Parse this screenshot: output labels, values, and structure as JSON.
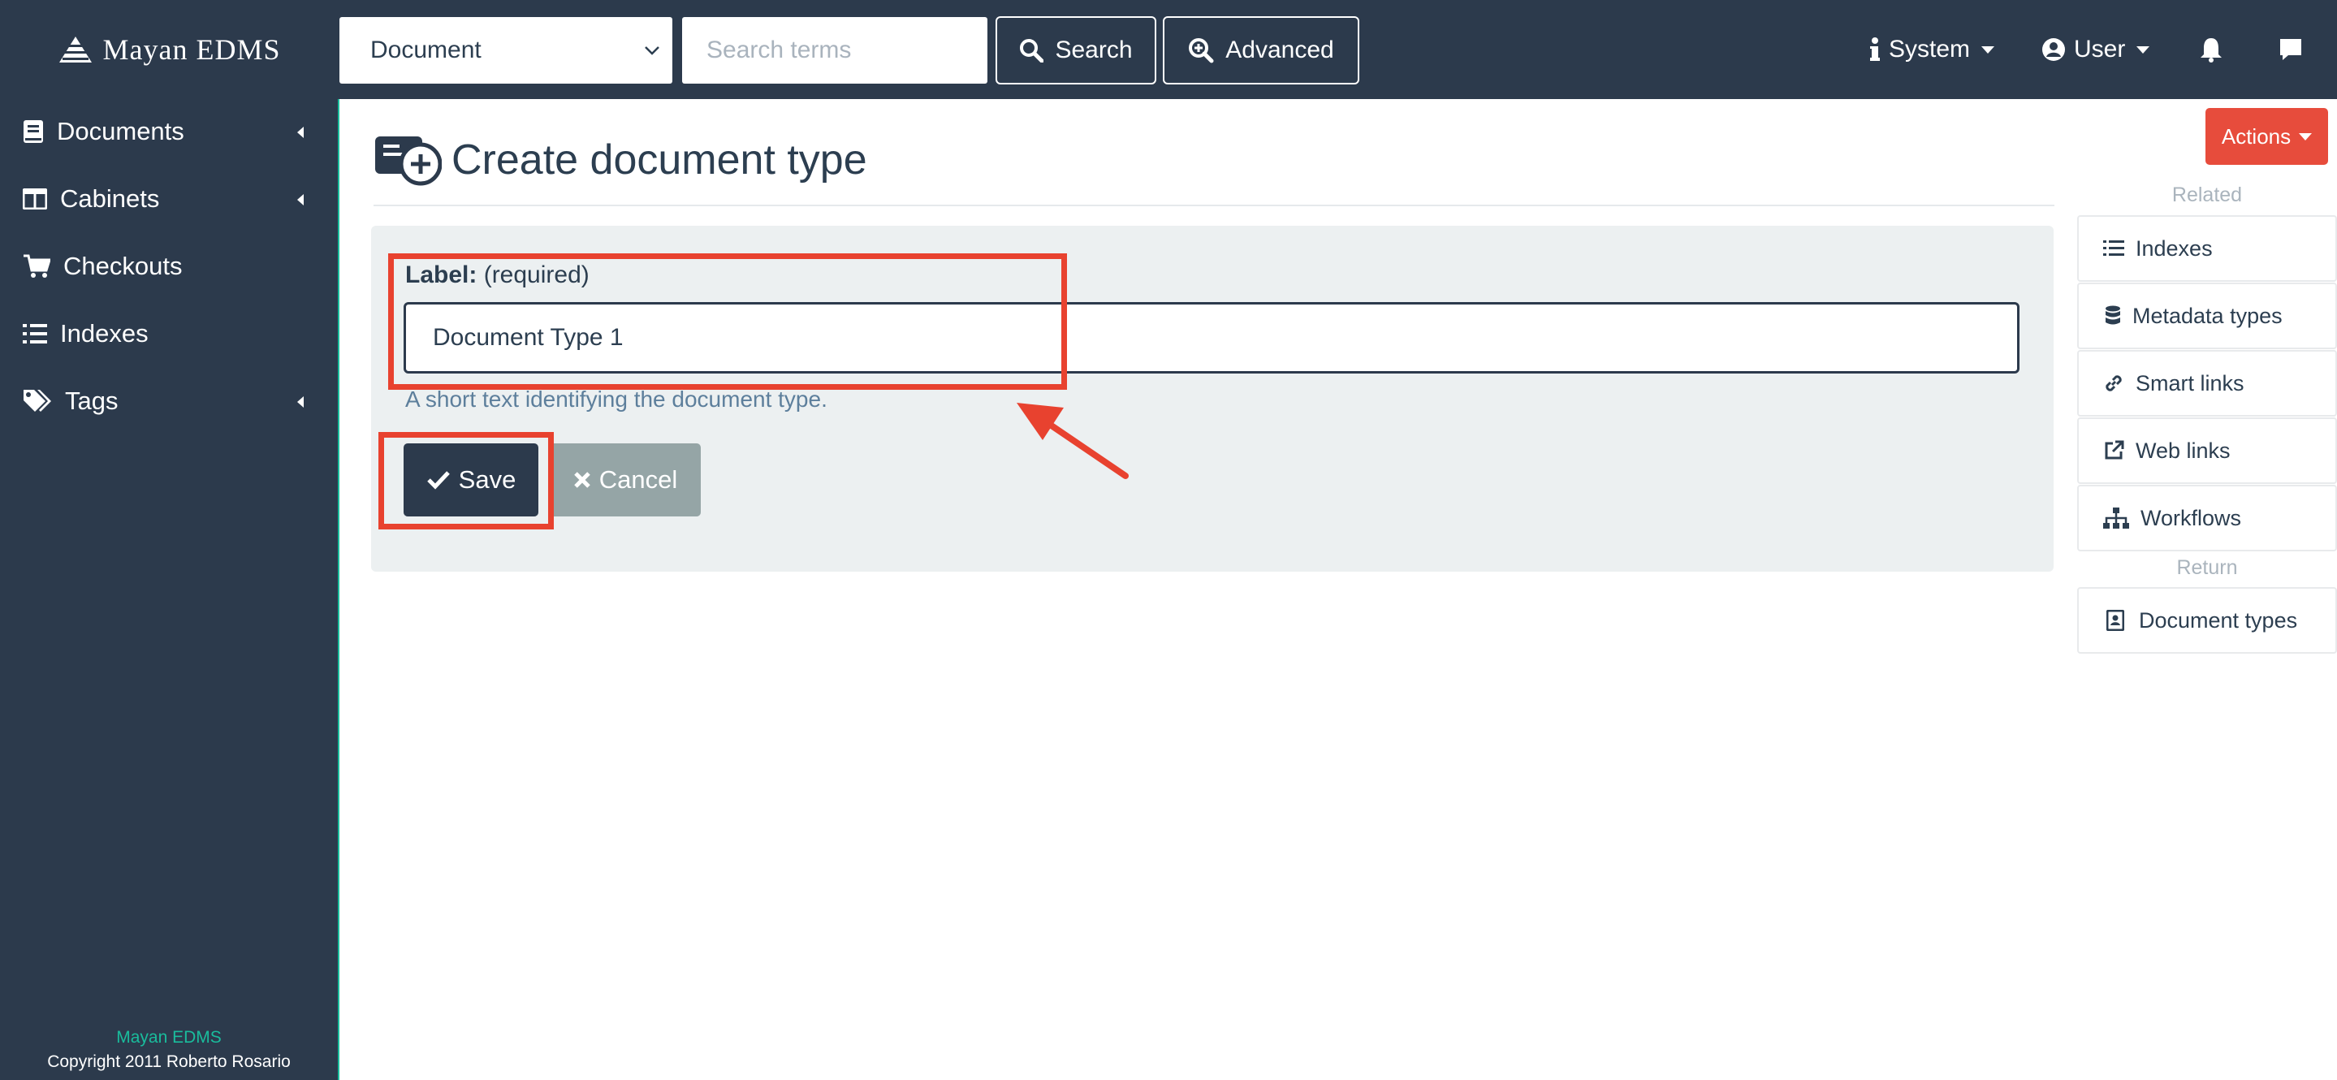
{
  "brand": {
    "name": "Mayan EDMS"
  },
  "search": {
    "scope_value": "Document",
    "placeholder": "Search terms",
    "search_label": "Search",
    "advanced_label": "Advanced"
  },
  "nav": {
    "system_label": "System",
    "user_label": "User"
  },
  "sidebar": {
    "items": [
      {
        "label": "Documents"
      },
      {
        "label": "Cabinets"
      },
      {
        "label": "Checkouts"
      },
      {
        "label": "Indexes"
      },
      {
        "label": "Tags"
      }
    ],
    "footer_brand": "Mayan EDMS",
    "footer_copyright": "Copyright 2011 Roberto Rosario"
  },
  "page": {
    "title": "Create document type"
  },
  "form": {
    "label_name": "Label:",
    "label_required": "(required)",
    "label_value": "Document Type 1",
    "help_text": "A short text identifying the document type.",
    "save_label": "Save",
    "cancel_label": "Cancel"
  },
  "actions": {
    "label": "Actions"
  },
  "related": {
    "heading": "Related",
    "items": [
      {
        "label": "Indexes",
        "icon": "list-icon"
      },
      {
        "label": "Metadata types",
        "icon": "database-icon"
      },
      {
        "label": "Smart links",
        "icon": "link-icon"
      },
      {
        "label": "Web links",
        "icon": "external-link-icon"
      },
      {
        "label": "Workflows",
        "icon": "sitemap-icon"
      }
    ],
    "return_heading": "Return",
    "return_items": [
      {
        "label": "Document types",
        "icon": "address-book-icon"
      }
    ]
  },
  "colors": {
    "navbar": "#2c3a4c",
    "accent": "#1abc9c",
    "danger": "#e74c3c",
    "annotation": "#e8422f"
  }
}
